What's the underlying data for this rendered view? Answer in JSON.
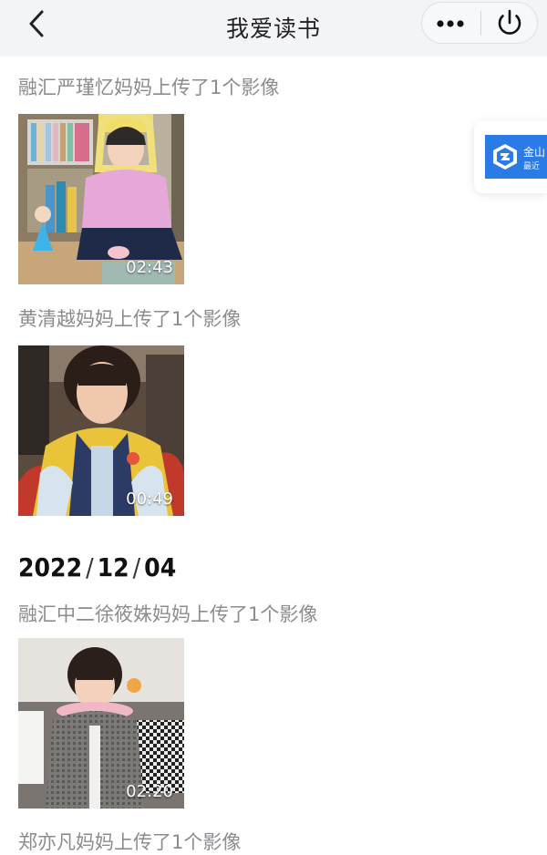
{
  "nav": {
    "title": "我爱读书",
    "back_icon": "chevron-left-icon",
    "more_icon": "more-dots-icon",
    "power_icon": "power-icon"
  },
  "feed": {
    "items": [
      {
        "title": "融汇严瑾忆妈妈上传了1个影像",
        "duration": "02:43"
      },
      {
        "title": "黄清越妈妈上传了1个影像",
        "duration": "00:49"
      }
    ],
    "date_group": {
      "year": "2022",
      "month": "12",
      "day": "04",
      "separator": "/",
      "items": [
        {
          "title": "融汇中二徐筱姝妈妈上传了1个影像",
          "duration": "02:20"
        },
        {
          "title": "郑亦凡妈妈上传了1个影像"
        }
      ]
    }
  },
  "floating_widget": {
    "label": "金山",
    "sub": "最近"
  },
  "colors": {
    "navbar_bg": "#f3f4f7",
    "upload_title": "#8b8c90",
    "accent_blue": "#2a7be6"
  }
}
